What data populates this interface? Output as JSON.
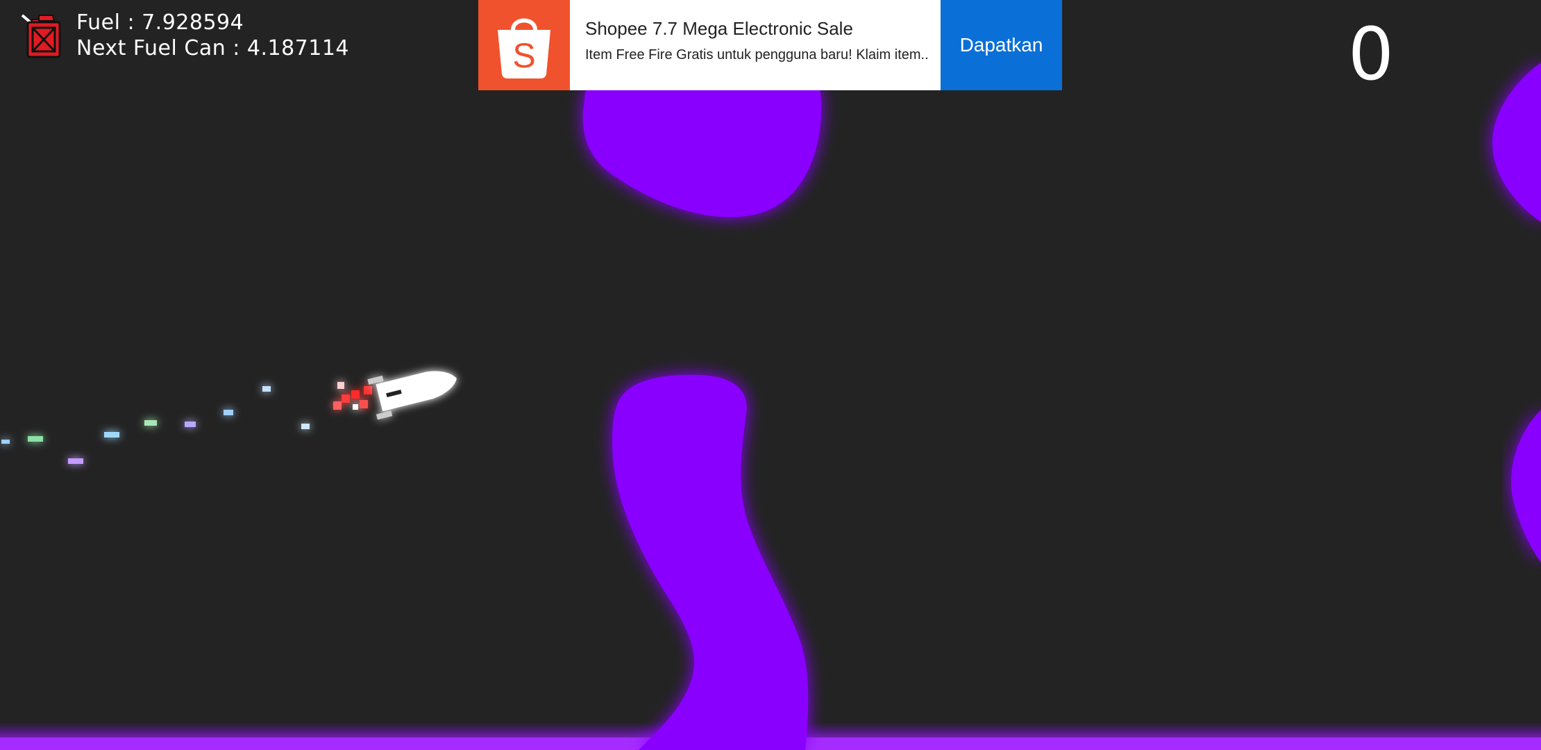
{
  "hud": {
    "fuel_label": "Fuel :",
    "fuel_value": "7.928594",
    "next_fuel_label": "Next Fuel Can :",
    "next_fuel_value": "4.187114",
    "score": "0",
    "fuel_icon": "fuel-can-icon"
  },
  "ad": {
    "title": "Shopee 7.7 Mega Electronic Sale",
    "description": "Item Free Fire Gratis untuk pengguna baru! Klaim item...",
    "cta": "Dapatkan",
    "logo_letter": "S",
    "logo_icon": "shopping-bag-icon"
  },
  "colors": {
    "background": "#232323",
    "obstacle": "#8a00ff",
    "obstacle_glow": "#b34dff",
    "ship": "#ffffff",
    "exhaust": "#ff3b3b",
    "ad_cta_bg": "#0a6fd6",
    "ad_logo_bg": "#f0522d",
    "fuel_icon": "#e01b22"
  }
}
